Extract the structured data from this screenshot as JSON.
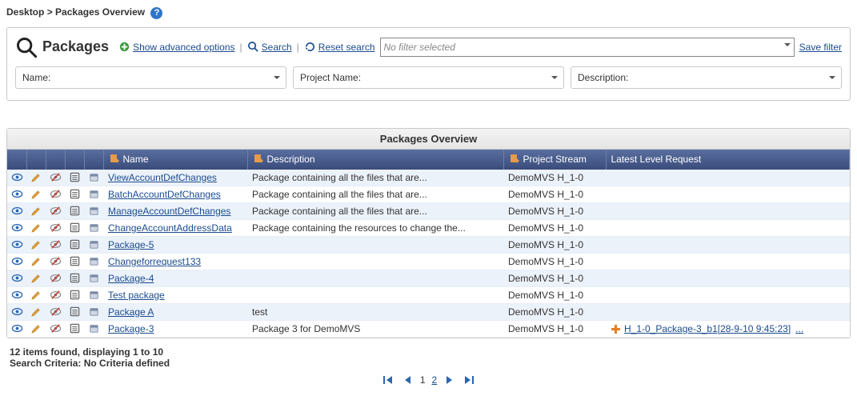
{
  "breadcrumb": {
    "root": "Desktop",
    "sep": ">",
    "current": "Packages Overview"
  },
  "search": {
    "title": "Packages",
    "advanced": "Show advanced options",
    "search": "Search",
    "reset": "Reset search",
    "filter_placeholder": "No filter selected",
    "save_filter": "Save filter",
    "criteria": {
      "name": "Name:",
      "project": "Project Name:",
      "description": "Description:"
    }
  },
  "table": {
    "title": "Packages Overview",
    "headers": {
      "name": "Name",
      "description": "Description",
      "project_stream": "Project Stream",
      "latest": "Latest Level Request"
    },
    "rows": [
      {
        "name": "ViewAccountDefChanges",
        "desc": "Package containing all the files that are...",
        "stream": "DemoMVS H_1-0",
        "latest": ""
      },
      {
        "name": "BatchAccountDefChanges",
        "desc": "Package containing all the files that are...",
        "stream": "DemoMVS H_1-0",
        "latest": ""
      },
      {
        "name": "ManageAccountDefChanges",
        "desc": "Package containing all the files that are...",
        "stream": "DemoMVS H_1-0",
        "latest": ""
      },
      {
        "name": "ChangeAccountAddressData",
        "desc": "Package containing the resources to change the...",
        "stream": "DemoMVS H_1-0",
        "latest": ""
      },
      {
        "name": "Package-5",
        "desc": "",
        "stream": "DemoMVS H_1-0",
        "latest": ""
      },
      {
        "name": "Changeforrequest133",
        "desc": "",
        "stream": "DemoMVS H_1-0",
        "latest": ""
      },
      {
        "name": "Package-4",
        "desc": "",
        "stream": "DemoMVS H_1-0",
        "latest": ""
      },
      {
        "name": "Test package",
        "desc": "",
        "stream": "DemoMVS H_1-0",
        "latest": ""
      },
      {
        "name": "Package A",
        "desc": "test",
        "stream": "DemoMVS H_1-0",
        "latest": ""
      },
      {
        "name": "Package-3",
        "desc": "Package 3 for DemoMVS",
        "stream": "DemoMVS H_1-0",
        "latest": "H_1-0_Package-3_b1[28-9-10 9:45:23]"
      }
    ]
  },
  "summary": {
    "line1": "12 items found, displaying 1 to 10",
    "line2": "Search Criteria: No Criteria defined"
  },
  "pager": {
    "current": "1",
    "next": "2"
  },
  "misc": {
    "ellipsis": "..."
  }
}
